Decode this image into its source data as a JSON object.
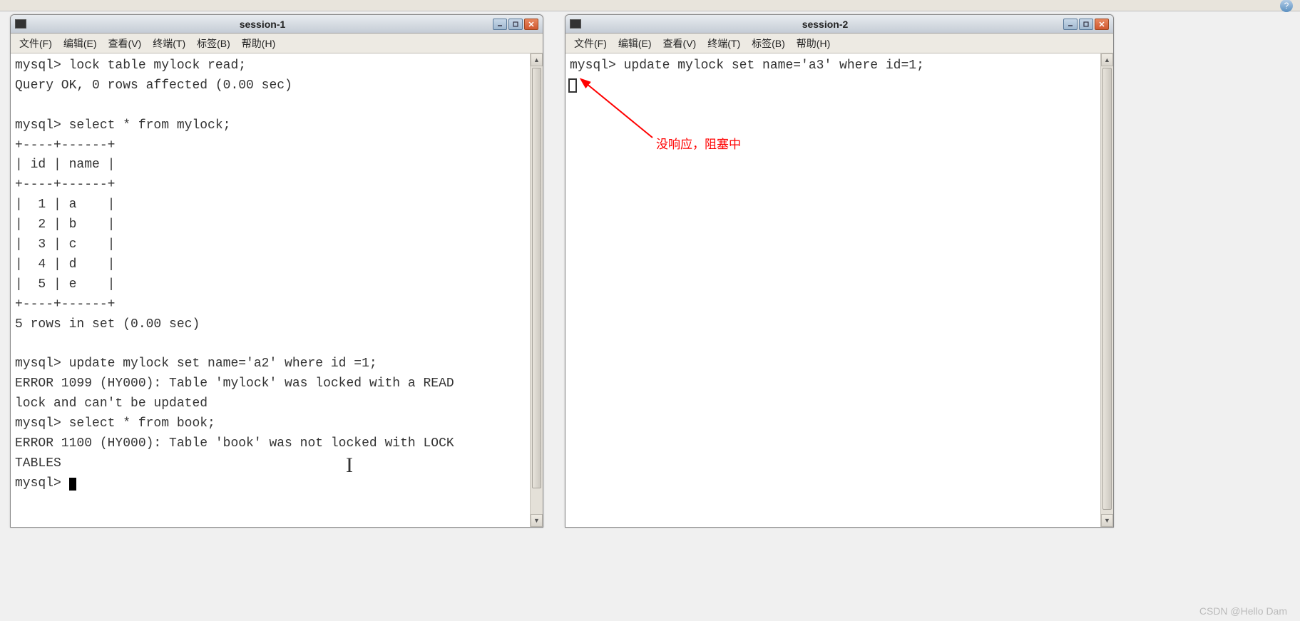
{
  "toolbar": {
    "help_tip": "?"
  },
  "menus": {
    "file": "文件(F)",
    "edit": "编辑(E)",
    "view": "查看(V)",
    "terminal": "终端(T)",
    "tabs": "标签(B)",
    "help": "帮助(H)"
  },
  "window1": {
    "title": "session-1",
    "terminal_text": "mysql> lock table mylock read;\nQuery OK, 0 rows affected (0.00 sec)\n\nmysql> select * from mylock;\n+----+------+\n| id | name |\n+----+------+\n|  1 | a    |\n|  2 | b    |\n|  3 | c    |\n|  4 | d    |\n|  5 | e    |\n+----+------+\n5 rows in set (0.00 sec)\n\nmysql> update mylock set name='a2' where id =1;\nERROR 1099 (HY000): Table 'mylock' was locked with a READ\nlock and can't be updated\nmysql> select * from book;\nERROR 1100 (HY000): Table 'book' was not locked with LOCK\nTABLES\nmysql> "
  },
  "window2": {
    "title": "session-2",
    "terminal_text": "mysql> update mylock set name='a3' where id=1;\n"
  },
  "annotation": {
    "text": "没响应，阻塞中"
  },
  "watermark": "CSDN @Hello Dam"
}
